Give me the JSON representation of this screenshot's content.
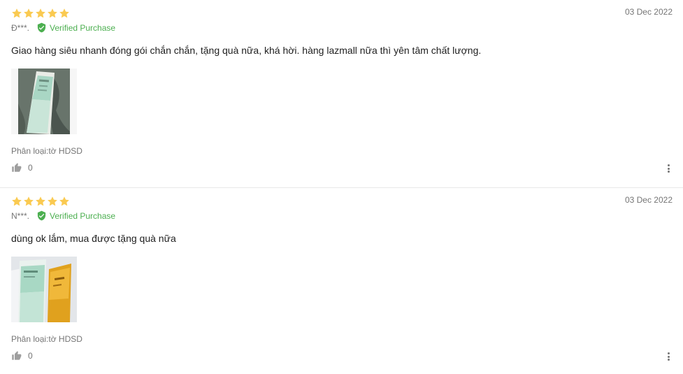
{
  "colors": {
    "star": "#faca51",
    "verified": "#4caf50",
    "muted_text": "#757575",
    "body_text": "#212121"
  },
  "reviews": [
    {
      "rating": 5,
      "date": "03 Dec 2022",
      "author": "Đ***.",
      "verified_label": "Verified Purchase",
      "content": "Giao hàng siêu nhanh đóng gói chắn chắn, tặng quà nữa, khá hời. hàng lazmall nữa thì yên tâm chất lượng.",
      "variant": "Phân loại:tờ HDSD",
      "likes": "0",
      "icons": {
        "verified": "shield-check-icon",
        "like": "thumbs-up-icon",
        "more": "more-vertical-icon"
      }
    },
    {
      "rating": 5,
      "date": "03 Dec 2022",
      "author": "N***.",
      "verified_label": "Verified Purchase",
      "content": "dùng ok lắm, mua được tặng quà nữa",
      "variant": "Phân loại:tờ HDSD",
      "likes": "0",
      "icons": {
        "verified": "shield-check-icon",
        "like": "thumbs-up-icon",
        "more": "more-vertical-icon"
      }
    }
  ]
}
